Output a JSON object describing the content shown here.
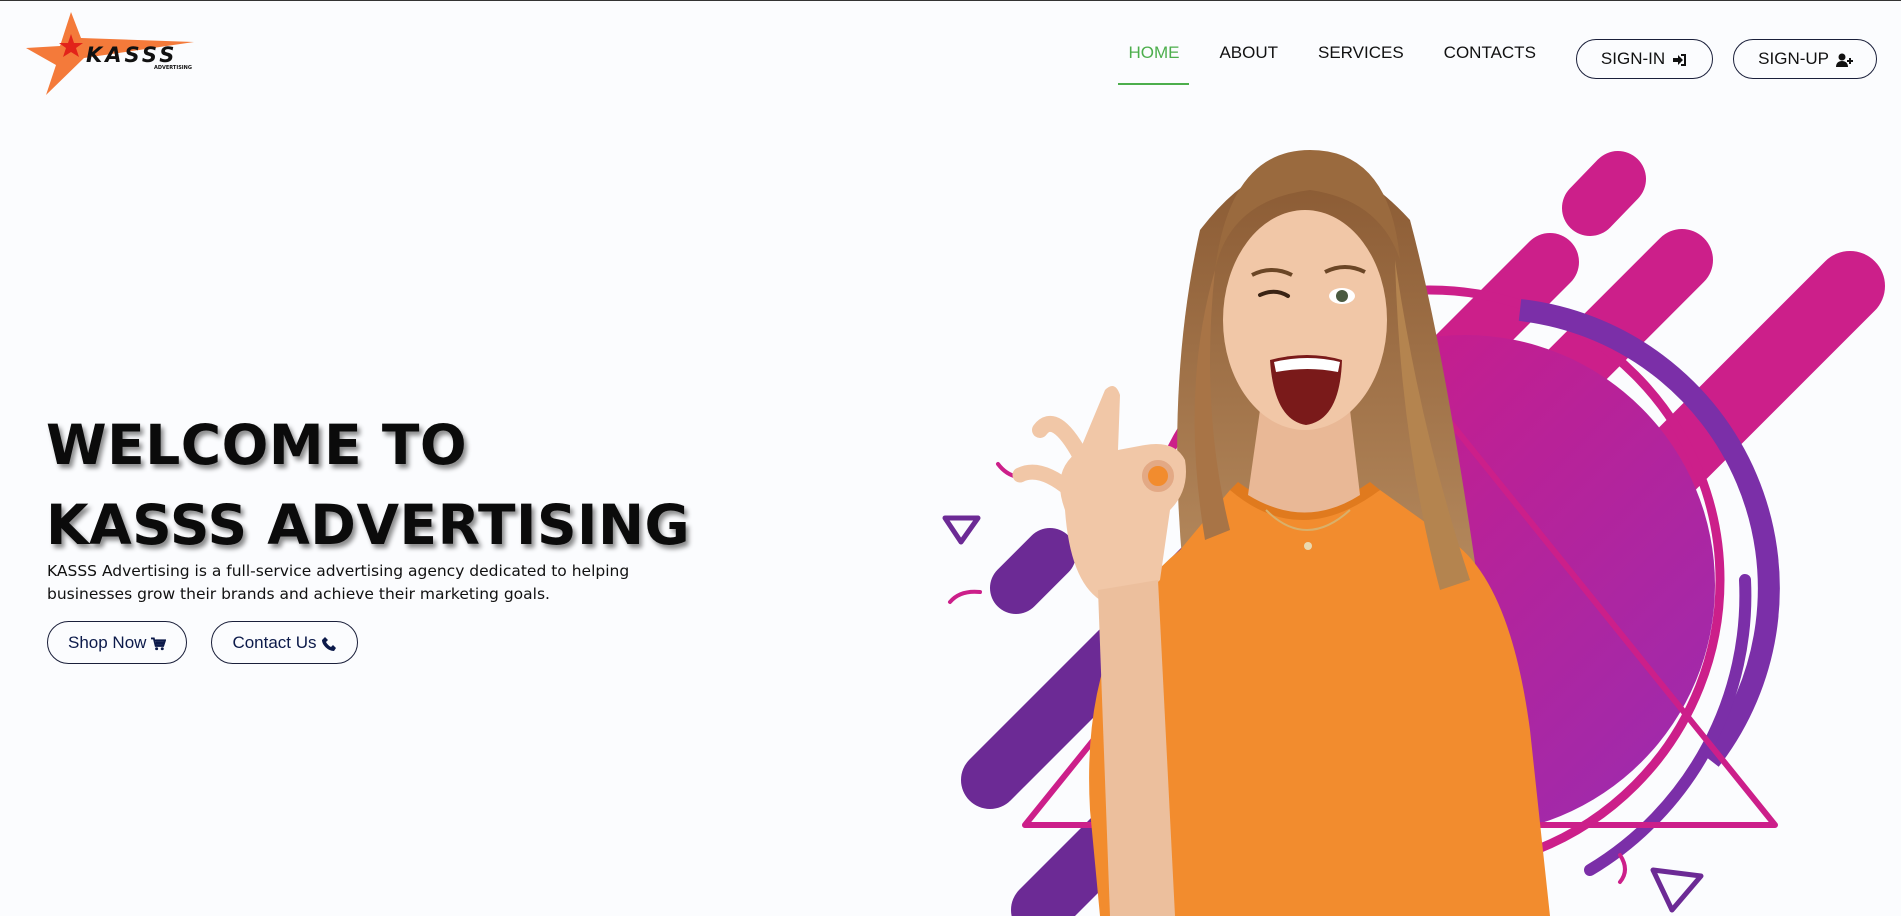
{
  "brand": {
    "logo_text": "KASSS",
    "logo_subtext": "ADVERTISING",
    "colors": {
      "star": "#f47a3a",
      "accent_green": "#4cae4c",
      "magenta": "#cc1f8a",
      "purple": "#7b2fa8",
      "shirt": "#f28c2e"
    }
  },
  "nav": {
    "items": [
      {
        "label": "HOME",
        "active": true
      },
      {
        "label": "ABOUT",
        "active": false
      },
      {
        "label": "SERVICES",
        "active": false
      },
      {
        "label": "CONTACTS",
        "active": false
      }
    ],
    "signin_label": "SIGN-IN",
    "signin_icon": "sign-in-icon",
    "signup_label": "SIGN-UP",
    "signup_icon": "user-plus-icon"
  },
  "hero": {
    "title_line1": "WELCOME TO",
    "title_line2": "KASSS ADVERTISING",
    "description": "KASSS Advertising is a full-service advertising agency dedicated to helping businesses grow their brands and achieve their marketing goals.",
    "shop_label": "Shop Now",
    "shop_icon": "cart-icon",
    "contact_label": "Contact Us",
    "contact_icon": "phone-icon"
  }
}
